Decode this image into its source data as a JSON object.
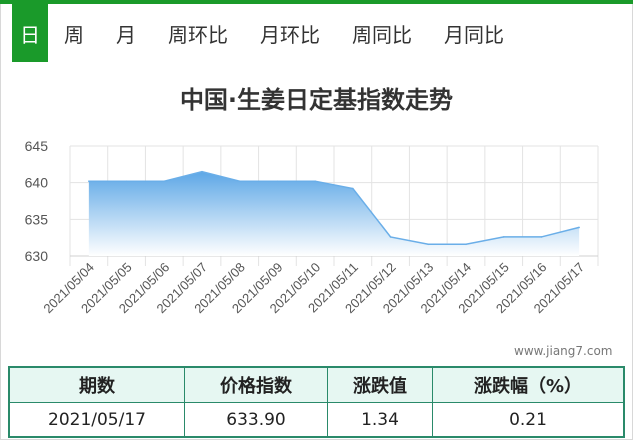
{
  "tabs": [
    {
      "label": "日",
      "active": true
    },
    {
      "label": "周",
      "active": false
    },
    {
      "label": "月",
      "active": false
    },
    {
      "label": "周环比",
      "active": false
    },
    {
      "label": "月环比",
      "active": false
    },
    {
      "label": "周同比",
      "active": false
    },
    {
      "label": "月同比",
      "active": false
    }
  ],
  "accent_color": "#1a9a2a",
  "chart_data": {
    "type": "area",
    "title": "中国·生姜日定基指数走势",
    "x": [
      "2021/05/04",
      "2021/05/05",
      "2021/05/06",
      "2021/05/07",
      "2021/05/08",
      "2021/05/09",
      "2021/05/10",
      "2021/05/11",
      "2021/05/12",
      "2021/05/13",
      "2021/05/14",
      "2021/05/15",
      "2021/05/16",
      "2021/05/17"
    ],
    "values": [
      640.2,
      640.2,
      640.2,
      641.5,
      640.2,
      640.2,
      640.2,
      639.2,
      632.6,
      631.6,
      631.6,
      632.6,
      632.6,
      633.9
    ],
    "yticks": [
      630,
      635,
      640,
      645
    ],
    "ylim": [
      630,
      645
    ],
    "grid": true,
    "line_color": "#6aaee8",
    "fill_top_color": "#5da7e6",
    "fill_bottom_color": "#ffffff"
  },
  "watermark": "www.jiang7.com",
  "summary": {
    "headers": [
      "期数",
      "价格指数",
      "涨跌值",
      "涨跌幅（%）"
    ],
    "row": [
      "2021/05/17",
      "633.90",
      "1.34",
      "0.21"
    ]
  }
}
